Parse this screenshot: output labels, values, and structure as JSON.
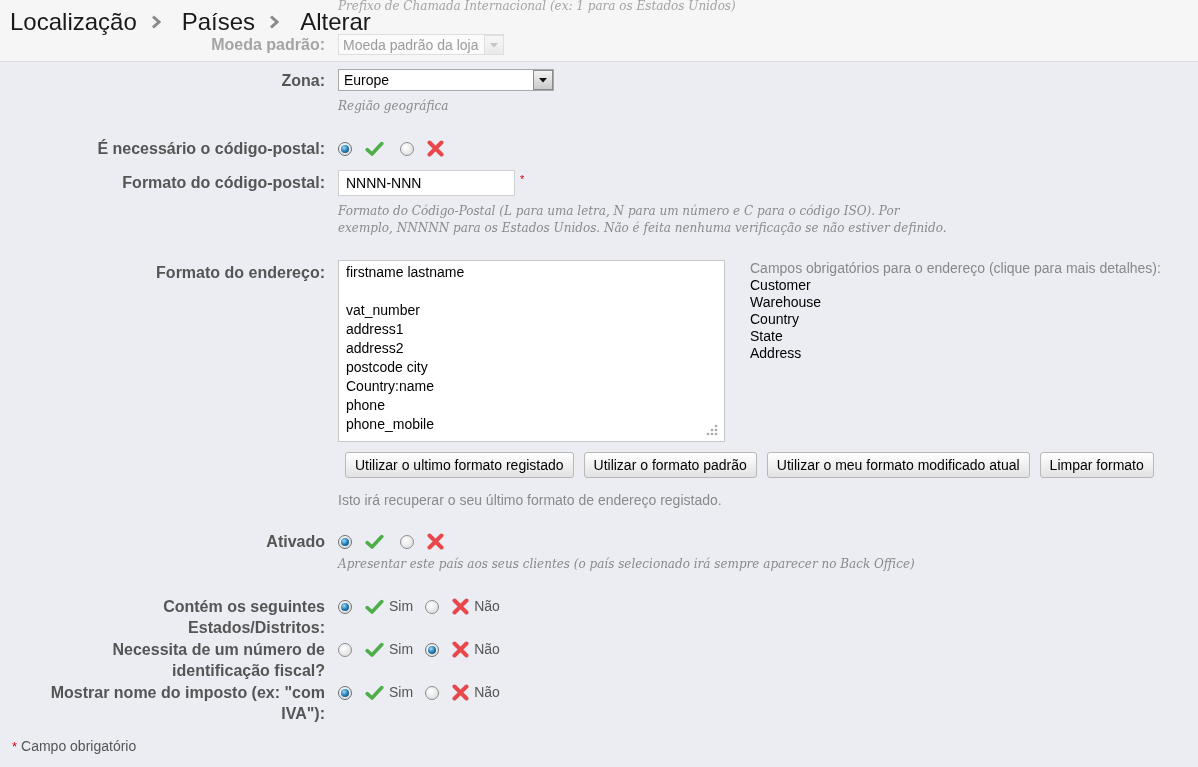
{
  "header": {
    "breadcrumb": [
      {
        "label": "Localização"
      },
      {
        "label": "Países"
      },
      {
        "label": "Alterar"
      }
    ],
    "behind": {
      "hint": "Prefixo de Chamada Internacional (ex: 1 para os Estados Unidos)",
      "label": "Moeda padrão:",
      "value": "Moeda padrão da loja"
    }
  },
  "form": {
    "fields": [
      {
        "kind": "select",
        "label": "Zona:",
        "value": "Europe",
        "hint": "Região geográfica"
      },
      {
        "kind": "toggle",
        "label": "É necessário o código-postal:",
        "options": [
          {
            "kind": "yes",
            "selected": true
          },
          {
            "kind": "no",
            "selected": false
          }
        ]
      },
      {
        "kind": "text",
        "label": "Formato do código-postal:",
        "value": "NNNN-NNN",
        "required_mark": "*",
        "hint": "Formato do Código-Postal (L para uma letra, N para um número e C para o código ISO). Por exemplo, NNNNN para os Estados Unidos. Não é feita nenhuma verificação se não estiver definido."
      },
      {
        "kind": "address",
        "label": "Formato do endereço:",
        "value": "firstname lastname\n\nvat_number\naddress1\naddress2\npostcode city\nCountry:name\nphone\nphone_mobile",
        "side_title": "Campos obrigatórios para o endereço (clique para mais detalhes):",
        "side_links": [
          "Customer",
          "Warehouse",
          "Country",
          "State",
          "Address"
        ],
        "buttons": [
          "Utilizar o ultimo formato registado",
          "Utilizar o formato padrão",
          "Utilizar o meu formato modificado atual",
          "Limpar formato"
        ],
        "hint": "Isto irá recuperar o seu último formato de endereço registado."
      },
      {
        "kind": "toggle",
        "label": "Ativado",
        "options": [
          {
            "kind": "yes",
            "selected": true
          },
          {
            "kind": "no",
            "selected": false
          }
        ],
        "hint": "Apresentar este país aos seus clientes (o país selecionado irá sempre aparecer no Back Office)"
      },
      {
        "kind": "toggle",
        "label": "Contém os seguintes Estados/Distritos:",
        "options": [
          {
            "kind": "yes",
            "label": "Sim",
            "selected": true
          },
          {
            "kind": "no",
            "label": "Não",
            "selected": false
          }
        ]
      },
      {
        "kind": "toggle",
        "label": "Necessita de um número de identificação fiscal?",
        "options": [
          {
            "kind": "yes",
            "label": "Sim",
            "selected": false
          },
          {
            "kind": "no",
            "label": "Não",
            "selected": true
          }
        ]
      },
      {
        "kind": "toggle",
        "label": "Mostrar nome do imposto (ex: \"com IVA\"):",
        "options": [
          {
            "kind": "yes",
            "label": "Sim",
            "selected": true
          },
          {
            "kind": "no",
            "label": "Não",
            "selected": false
          }
        ]
      }
    ]
  },
  "footer": {
    "mark": "*",
    "text": "Campo obrigatório"
  }
}
